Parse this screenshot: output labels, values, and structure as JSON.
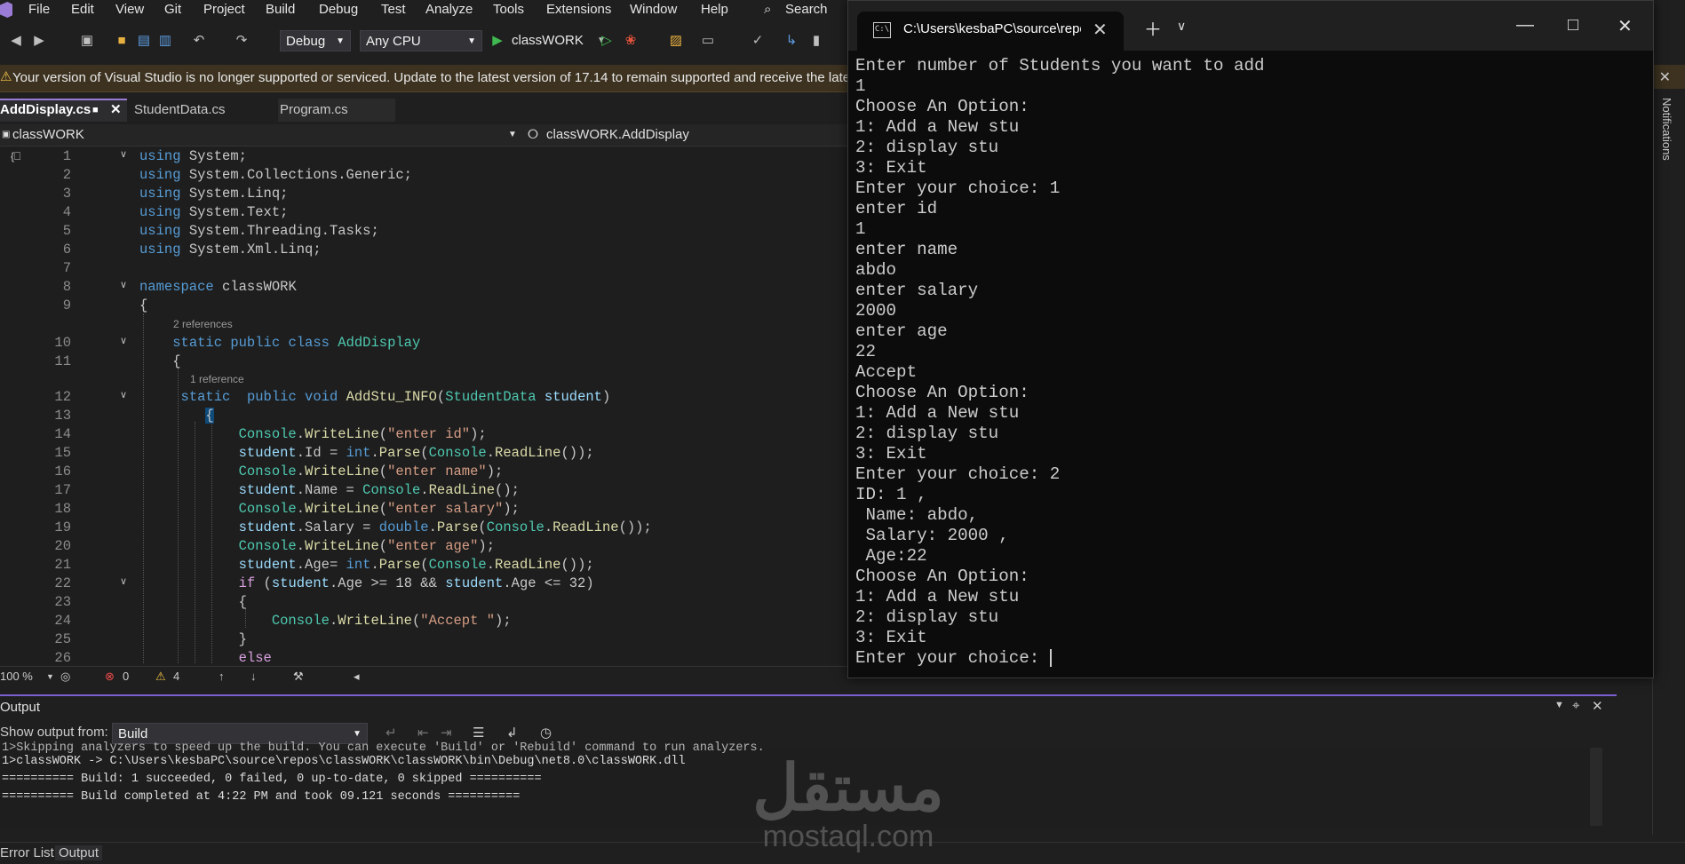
{
  "menu": [
    "File",
    "Edit",
    "View",
    "Git",
    "Project",
    "Build",
    "Debug",
    "Test",
    "Analyze",
    "Tools",
    "Extensions",
    "Window",
    "Help"
  ],
  "search_label": "Search",
  "toolbar": {
    "config": "Debug",
    "platform": "Any CPU",
    "run_target": "classWORK"
  },
  "infobar": {
    "message": "Your version of Visual Studio is no longer supported or serviced. Update to the latest version of 17.14 to remain supported and receive the late"
  },
  "tabs": [
    {
      "label": "AddDisplay.cs",
      "active": true
    },
    {
      "label": "StudentData.cs",
      "active": false
    },
    {
      "label": "Program.cs",
      "active": false
    }
  ],
  "navbar": {
    "project": "classWORK",
    "scope": "classWORK.AddDisplay"
  },
  "code": {
    "line_numbers": [
      "1",
      "2",
      "3",
      "4",
      "5",
      "6",
      "7",
      "8",
      "9",
      "10",
      "11",
      "12",
      "13",
      "14",
      "15",
      "16",
      "17",
      "18",
      "19",
      "20",
      "21",
      "22",
      "23",
      "24",
      "25",
      "26"
    ],
    "refs": {
      "class_refs": "2 references",
      "method_refs": "1 reference"
    }
  },
  "status": {
    "zoom": "100 %",
    "errors": "0",
    "warnings": "4"
  },
  "output": {
    "title": "Output",
    "show_from_label": "Show output from:",
    "source": "Build",
    "lines": [
      "1>Skipping analyzers to speed up the build. You can execute 'Build' or 'Rebuild' command to run analyzers.",
      "1>classWORK -> C:\\Users\\kesbaPC\\source\\repos\\classWORK\\classWORK\\bin\\Debug\\net8.0\\classWORK.dll",
      "========== Build: 1 succeeded, 0 failed, 0 up-to-date, 0 skipped ==========",
      "========== Build completed at 4:22 PM and took 09.121 seconds =========="
    ]
  },
  "bottom_tabs": [
    "Error List",
    "Output"
  ],
  "right_panel": "Notifications",
  "watermark": {
    "arabic": "مستقل",
    "latin": "mostaql.com"
  },
  "terminal": {
    "tab_title": "C:\\Users\\kesbaPC\\source\\repos",
    "lines": [
      "Enter number of Students you want to add",
      "1",
      "Choose An Option:",
      "1: Add a New stu",
      "2: display stu",
      "3: Exit",
      "Enter your choice: 1",
      "enter id",
      "1",
      "enter name",
      "abdo",
      "enter salary",
      "2000",
      "enter age",
      "22",
      "Accept",
      "Choose An Option:",
      "1: Add a New stu",
      "2: display stu",
      "3: Exit",
      "Enter your choice: 2",
      "ID: 1 ,",
      " Name: abdo,",
      " Salary: 2000 ,",
      " Age:22",
      "Choose An Option:",
      "1: Add a New stu",
      "2: display stu",
      "3: Exit"
    ],
    "prompt": "Enter your choice: "
  }
}
